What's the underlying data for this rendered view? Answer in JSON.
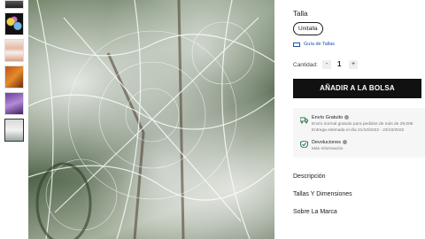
{
  "product": {
    "size_label": "Talla",
    "size_option": "Unitalla",
    "size_guide": "Guía de Tallas",
    "quantity_label": "Cantidad:",
    "quantity_value": "1",
    "quantity_minus": "-",
    "quantity_plus": "+",
    "add_to_bag": "AÑADIR A LA BOLSA"
  },
  "info": {
    "shipping_title": "Envío Gratuito",
    "shipping_line1": "Envío normal gratuito para pedidos de más de 29,00€",
    "shipping_line2": "Entrega estimada el día 21/10/2022 - 23/10/2022",
    "returns_title": "Devoluciones",
    "returns_more": "Más Información"
  },
  "sections": {
    "description": "Descripción",
    "sizes": "Tallas Y Dimensiones",
    "brand": "Sobre La Marca"
  },
  "icons": [
    "truck-icon",
    "shield-icon",
    "ruler-icon",
    "info-icon"
  ],
  "colors": {
    "button_bg": "#111111",
    "link_blue": "#1d4fa3",
    "info_bg": "#f6f6f6",
    "icon_green": "#2e7d4f"
  }
}
